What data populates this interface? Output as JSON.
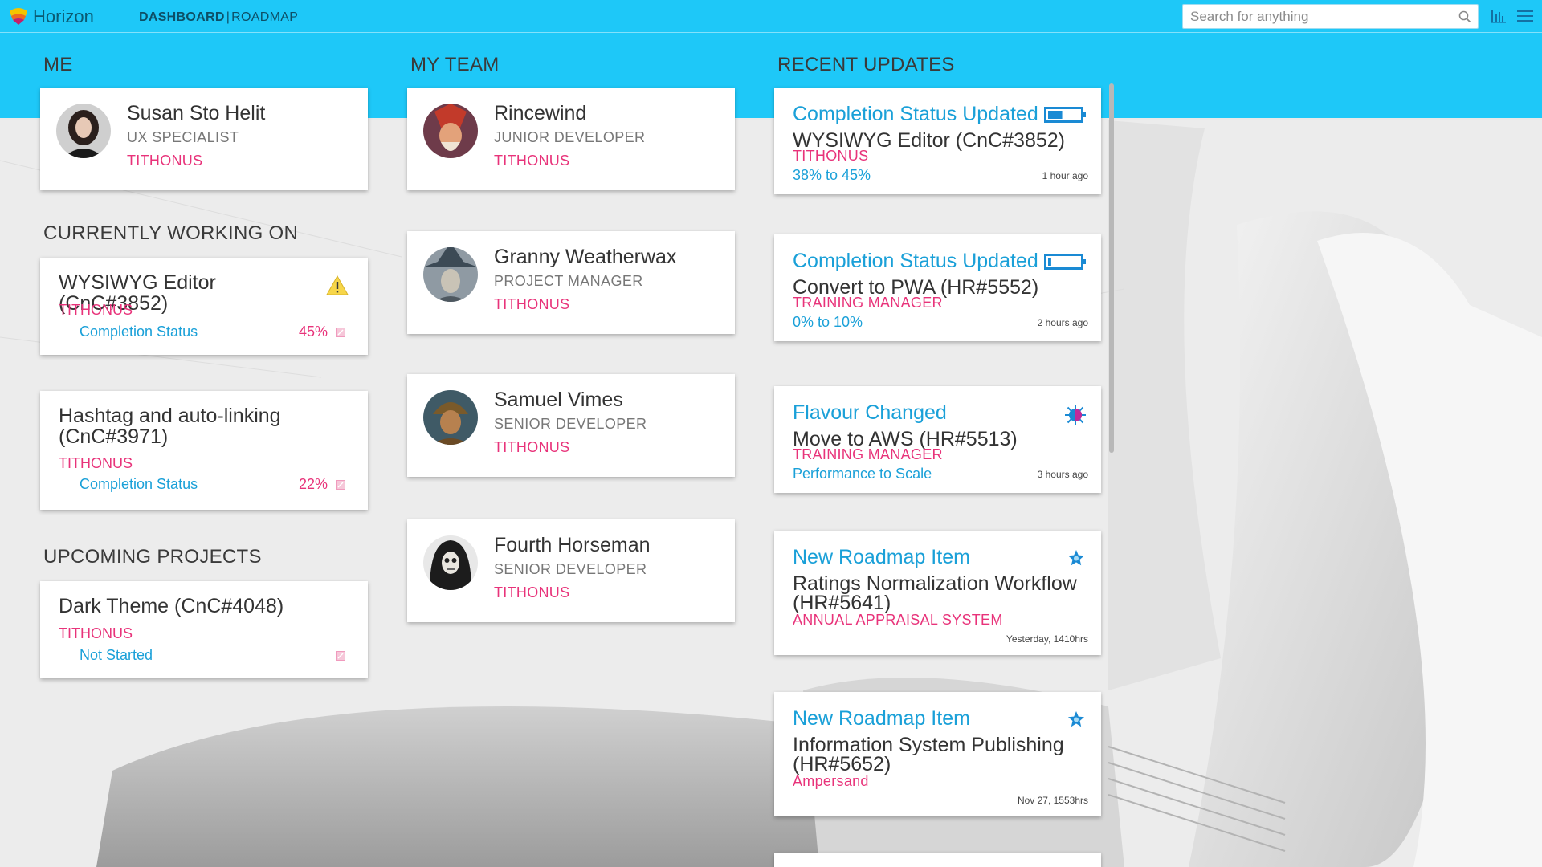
{
  "app": {
    "name": "Horizon"
  },
  "nav": {
    "active": "DASHBOARD",
    "separator": "|",
    "other": "ROADMAP"
  },
  "search": {
    "placeholder": "Search for anything",
    "value": ""
  },
  "sections": {
    "me": "ME",
    "my_team": "MY TEAM",
    "recent_updates": "RECENT UPDATES",
    "currently_working_on": "CURRENTLY WORKING ON",
    "upcoming_projects": "UPCOMING PROJECTS"
  },
  "me": {
    "name": "Susan Sto Helit",
    "role": "UX SPECIALIST",
    "team": "TITHONUS",
    "avatar": "avatar-susan"
  },
  "working_on": [
    {
      "title": "WYSIWYG Editor (CnC#3852)",
      "team": "TITHONUS",
      "status": "Completion Status",
      "percent": "45%",
      "warning": true
    },
    {
      "title": "Hashtag and auto-linking (CnC#3971)",
      "team": "TITHONUS",
      "status": "Completion Status",
      "percent": "22%",
      "warning": false
    }
  ],
  "upcoming": [
    {
      "title": "Dark Theme (CnC#4048)",
      "team": "TITHONUS",
      "status": "Not Started"
    }
  ],
  "team": [
    {
      "name": "Rincewind",
      "role": "JUNIOR DEVELOPER",
      "team": "TITHONUS",
      "avatar": "avatar-rincewind"
    },
    {
      "name": "Granny Weatherwax",
      "role": "PROJECT MANAGER",
      "team": "TITHONUS",
      "avatar": "avatar-granny"
    },
    {
      "name": "Samuel Vimes",
      "role": "SENIOR DEVELOPER",
      "team": "TITHONUS",
      "avatar": "avatar-vimes"
    },
    {
      "name": "Fourth Horseman",
      "role": "SENIOR DEVELOPER",
      "team": "TITHONUS",
      "avatar": "avatar-death"
    }
  ],
  "updates": [
    {
      "type": "Completion Status Updated",
      "icon": "battery-icon",
      "item": "WYSIWYG Editor (CnC#3852)",
      "team": "TITHONUS",
      "detail": "38% to 45%",
      "time": "1 hour ago",
      "fill": 0.45
    },
    {
      "type": "Completion Status Updated",
      "icon": "battery-icon",
      "item": "Convert to PWA (HR#5552)",
      "team": "TRAINING MANAGER",
      "detail": "0% to 10%",
      "time": "2 hours ago",
      "fill": 0.1
    },
    {
      "type": "Flavour Changed",
      "icon": "flavour-icon",
      "item": "Move to AWS (HR#5513)",
      "team": "TRAINING MANAGER",
      "detail": "Performance to Scale",
      "time": "3 hours ago"
    },
    {
      "type": "New Roadmap Item",
      "icon": "star-icon",
      "item": "Ratings Normalization Workflow (HR#5641)",
      "team": "ANNUAL APPRAISAL SYSTEM",
      "detail": "",
      "time": "Yesterday, 1410hrs"
    },
    {
      "type": "New Roadmap Item",
      "icon": "star-icon",
      "item": "Information System Publishing (HR#5652)",
      "team": "Ampersand",
      "detail": "",
      "time": "Nov 27, 1553hrs"
    }
  ],
  "colors": {
    "accent_blue": "#1ec8f8",
    "link_blue": "#1aa0d8",
    "pink": "#e8337a",
    "text": "#333333"
  }
}
